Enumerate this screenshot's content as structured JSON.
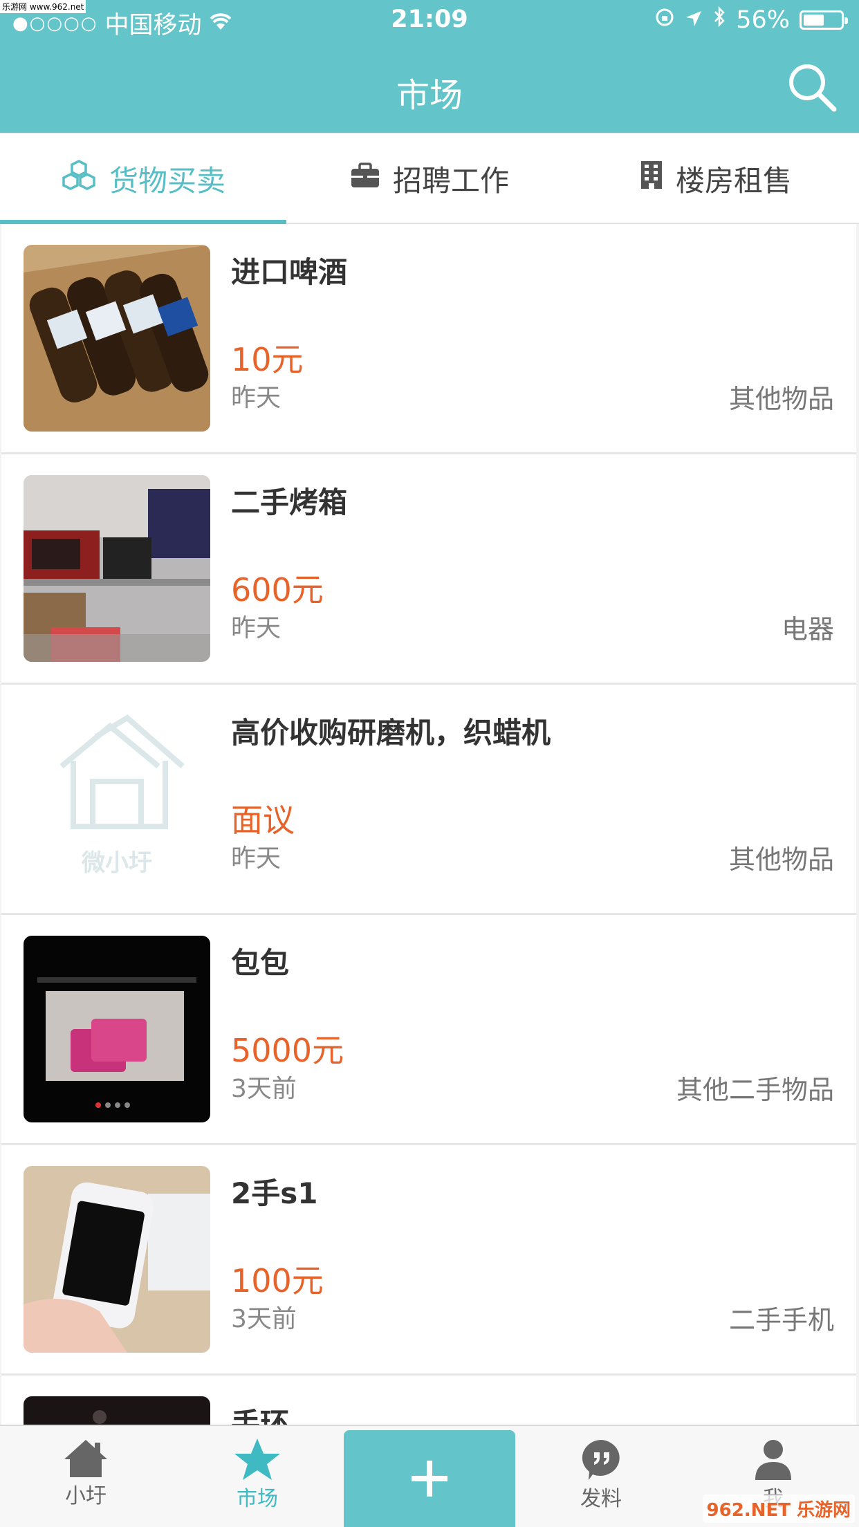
{
  "watermark": "乐游网 www.962.net",
  "status_bar": {
    "signal_dots": "●○○○○",
    "carrier": "中国移动",
    "time": "21:09",
    "battery": "56%",
    "battery_level": 0.56
  },
  "nav": {
    "title": "市场",
    "search_icon": "search-icon"
  },
  "tabs": [
    {
      "label": "货物买卖",
      "icon": "cubes-icon",
      "active": true
    },
    {
      "label": "招聘工作",
      "icon": "briefcase-icon",
      "active": false
    },
    {
      "label": "楼房租售",
      "icon": "building-icon",
      "active": false
    }
  ],
  "listings": [
    {
      "title": "进口啤酒",
      "price": "10元",
      "time": "昨天",
      "category": "其他物品"
    },
    {
      "title": "二手烤箱",
      "price": "600元",
      "time": "昨天",
      "category": "电器"
    },
    {
      "title": "高价收购研磨机，织蜡机",
      "price": "面议",
      "time": "昨天",
      "category": "其他物品",
      "placeholder_text": "微小圩"
    },
    {
      "title": "包包",
      "price": "5000元",
      "time": "3天前",
      "category": "其他二手物品"
    },
    {
      "title": "2手s1",
      "price": "100元",
      "time": "3天前",
      "category": "二手手机"
    },
    {
      "title": "手环",
      "price": "",
      "time": "",
      "category": ""
    }
  ],
  "tabbar": {
    "items": [
      {
        "label": "小圩",
        "icon": "home-icon"
      },
      {
        "label": "市场",
        "icon": "star-icon",
        "active": true
      },
      {
        "label": "",
        "icon": "plus-icon"
      },
      {
        "label": "发料",
        "icon": "quote-bubble-icon"
      },
      {
        "label": "我",
        "icon": "person-icon"
      }
    ]
  },
  "corner_watermark": "962.NET 乐游网",
  "colors": {
    "primary": "#63c5c9",
    "accent_tab": "#56bec4",
    "price": "#e8632a"
  }
}
